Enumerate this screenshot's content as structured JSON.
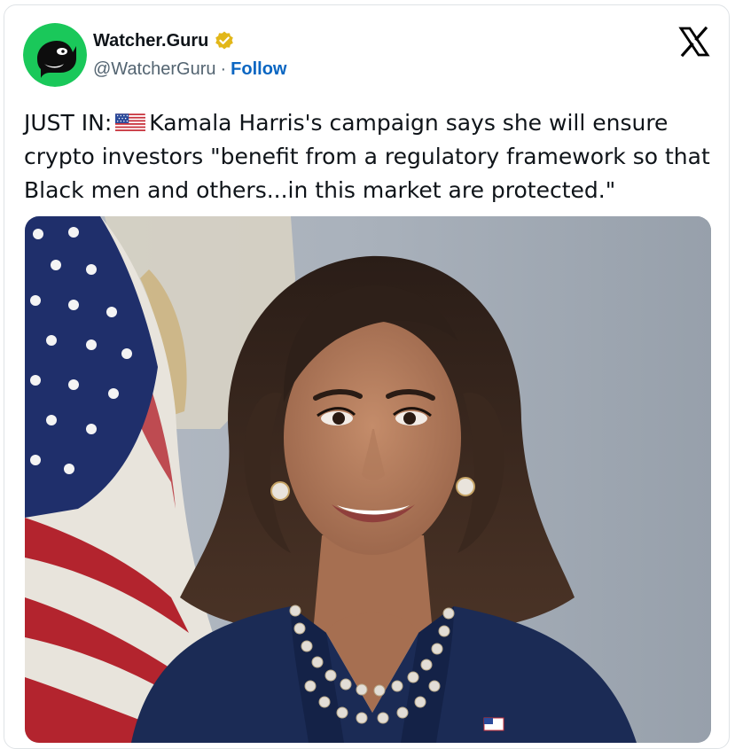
{
  "account": {
    "display_name": "Watcher.Guru",
    "handle": "@WatcherGuru",
    "separator": "·",
    "follow_label": "Follow",
    "verified_color": "#e2b719"
  },
  "post": {
    "text_prefix": "JUST IN:",
    "text_body": "Kamala Harris's campaign says she will ensure crypto investors \"benefit from a regulatory framework so that Black men and others...in this market are protected.\"",
    "flag_icon": "us-flag-emoji"
  },
  "platform": {
    "logo": "x-logo",
    "brand_color": "#000000"
  },
  "colors": {
    "avatar_bg": "#1ac85a",
    "follow_link": "#0a66c2",
    "muted_text": "#536471"
  }
}
